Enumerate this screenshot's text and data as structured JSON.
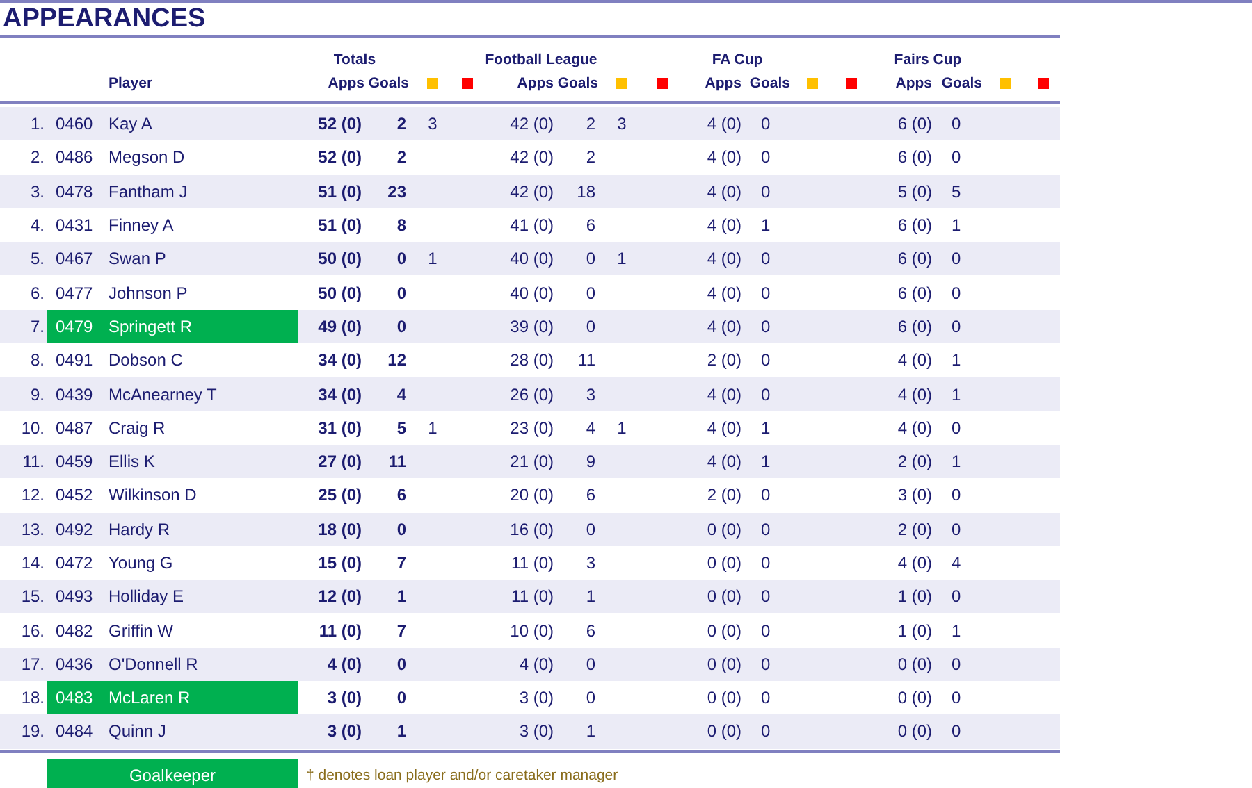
{
  "title": "APPEARANCES",
  "player_header": "Player",
  "groups": [
    {
      "title": "Totals",
      "apps_label": "Apps",
      "goals_label": "Goals"
    },
    {
      "title": "Football League",
      "apps_label": "Apps",
      "goals_label": "Goals"
    },
    {
      "title": "FA Cup",
      "apps_label": "Apps",
      "goals_label": "Goals"
    },
    {
      "title": "Fairs Cup",
      "apps_label": "Apps",
      "goals_label": "Goals"
    }
  ],
  "rows": [
    {
      "rank": "1.",
      "id": "0460",
      "name": "Kay A",
      "goalkeeper": false,
      "stats": [
        {
          "apps": "52 (0)",
          "goals": "2",
          "yellow": "3"
        },
        {
          "apps": "42 (0)",
          "goals": "2",
          "yellow": "3"
        },
        {
          "apps": "4 (0)",
          "goals": "0"
        },
        {
          "apps": "6 (0)",
          "goals": "0"
        }
      ]
    },
    {
      "rank": "2.",
      "id": "0486",
      "name": "Megson D",
      "goalkeeper": false,
      "stats": [
        {
          "apps": "52 (0)",
          "goals": "2"
        },
        {
          "apps": "42 (0)",
          "goals": "2"
        },
        {
          "apps": "4 (0)",
          "goals": "0"
        },
        {
          "apps": "6 (0)",
          "goals": "0"
        }
      ]
    },
    {
      "rank": "3.",
      "id": "0478",
      "name": "Fantham J",
      "goalkeeper": false,
      "stats": [
        {
          "apps": "51 (0)",
          "goals": "23"
        },
        {
          "apps": "42 (0)",
          "goals": "18"
        },
        {
          "apps": "4 (0)",
          "goals": "0"
        },
        {
          "apps": "5 (0)",
          "goals": "5"
        }
      ]
    },
    {
      "rank": "4.",
      "id": "0431",
      "name": "Finney A",
      "goalkeeper": false,
      "stats": [
        {
          "apps": "51 (0)",
          "goals": "8"
        },
        {
          "apps": "41 (0)",
          "goals": "6"
        },
        {
          "apps": "4 (0)",
          "goals": "1"
        },
        {
          "apps": "6 (0)",
          "goals": "1"
        }
      ]
    },
    {
      "rank": "5.",
      "id": "0467",
      "name": "Swan P",
      "goalkeeper": false,
      "stats": [
        {
          "apps": "50 (0)",
          "goals": "0",
          "yellow": "1"
        },
        {
          "apps": "40 (0)",
          "goals": "0",
          "yellow": "1"
        },
        {
          "apps": "4 (0)",
          "goals": "0"
        },
        {
          "apps": "6 (0)",
          "goals": "0"
        }
      ]
    },
    {
      "rank": "6.",
      "id": "0477",
      "name": "Johnson P",
      "goalkeeper": false,
      "stats": [
        {
          "apps": "50 (0)",
          "goals": "0"
        },
        {
          "apps": "40 (0)",
          "goals": "0"
        },
        {
          "apps": "4 (0)",
          "goals": "0"
        },
        {
          "apps": "6 (0)",
          "goals": "0"
        }
      ]
    },
    {
      "rank": "7.",
      "id": "0479",
      "name": "Springett R",
      "goalkeeper": true,
      "stats": [
        {
          "apps": "49 (0)",
          "goals": "0"
        },
        {
          "apps": "39 (0)",
          "goals": "0"
        },
        {
          "apps": "4 (0)",
          "goals": "0"
        },
        {
          "apps": "6 (0)",
          "goals": "0"
        }
      ]
    },
    {
      "rank": "8.",
      "id": "0491",
      "name": "Dobson C",
      "goalkeeper": false,
      "stats": [
        {
          "apps": "34 (0)",
          "goals": "12"
        },
        {
          "apps": "28 (0)",
          "goals": "11"
        },
        {
          "apps": "2 (0)",
          "goals": "0"
        },
        {
          "apps": "4 (0)",
          "goals": "1"
        }
      ]
    },
    {
      "rank": "9.",
      "id": "0439",
      "name": "McAnearney T",
      "goalkeeper": false,
      "stats": [
        {
          "apps": "34 (0)",
          "goals": "4"
        },
        {
          "apps": "26 (0)",
          "goals": "3"
        },
        {
          "apps": "4 (0)",
          "goals": "0"
        },
        {
          "apps": "4 (0)",
          "goals": "1"
        }
      ]
    },
    {
      "rank": "10.",
      "id": "0487",
      "name": "Craig R",
      "goalkeeper": false,
      "stats": [
        {
          "apps": "31 (0)",
          "goals": "5",
          "yellow": "1"
        },
        {
          "apps": "23 (0)",
          "goals": "4",
          "yellow": "1"
        },
        {
          "apps": "4 (0)",
          "goals": "1"
        },
        {
          "apps": "4 (0)",
          "goals": "0"
        }
      ]
    },
    {
      "rank": "11.",
      "id": "0459",
      "name": "Ellis K",
      "goalkeeper": false,
      "stats": [
        {
          "apps": "27 (0)",
          "goals": "11"
        },
        {
          "apps": "21 (0)",
          "goals": "9"
        },
        {
          "apps": "4 (0)",
          "goals": "1"
        },
        {
          "apps": "2 (0)",
          "goals": "1"
        }
      ]
    },
    {
      "rank": "12.",
      "id": "0452",
      "name": "Wilkinson D",
      "goalkeeper": false,
      "stats": [
        {
          "apps": "25 (0)",
          "goals": "6"
        },
        {
          "apps": "20 (0)",
          "goals": "6"
        },
        {
          "apps": "2 (0)",
          "goals": "0"
        },
        {
          "apps": "3 (0)",
          "goals": "0"
        }
      ]
    },
    {
      "rank": "13.",
      "id": "0492",
      "name": "Hardy R",
      "goalkeeper": false,
      "stats": [
        {
          "apps": "18 (0)",
          "goals": "0"
        },
        {
          "apps": "16 (0)",
          "goals": "0"
        },
        {
          "apps": "0 (0)",
          "goals": "0"
        },
        {
          "apps": "2 (0)",
          "goals": "0"
        }
      ]
    },
    {
      "rank": "14.",
      "id": "0472",
      "name": "Young G",
      "goalkeeper": false,
      "stats": [
        {
          "apps": "15 (0)",
          "goals": "7"
        },
        {
          "apps": "11 (0)",
          "goals": "3"
        },
        {
          "apps": "0 (0)",
          "goals": "0"
        },
        {
          "apps": "4 (0)",
          "goals": "4"
        }
      ]
    },
    {
      "rank": "15.",
      "id": "0493",
      "name": "Holliday E",
      "goalkeeper": false,
      "stats": [
        {
          "apps": "12 (0)",
          "goals": "1"
        },
        {
          "apps": "11 (0)",
          "goals": "1"
        },
        {
          "apps": "0 (0)",
          "goals": "0"
        },
        {
          "apps": "1 (0)",
          "goals": "0"
        }
      ]
    },
    {
      "rank": "16.",
      "id": "0482",
      "name": "Griffin W",
      "goalkeeper": false,
      "stats": [
        {
          "apps": "11 (0)",
          "goals": "7"
        },
        {
          "apps": "10 (0)",
          "goals": "6"
        },
        {
          "apps": "0 (0)",
          "goals": "0"
        },
        {
          "apps": "1 (0)",
          "goals": "1"
        }
      ]
    },
    {
      "rank": "17.",
      "id": "0436",
      "name": "O'Donnell R",
      "goalkeeper": false,
      "stats": [
        {
          "apps": "4 (0)",
          "goals": "0"
        },
        {
          "apps": "4 (0)",
          "goals": "0"
        },
        {
          "apps": "0 (0)",
          "goals": "0"
        },
        {
          "apps": "0 (0)",
          "goals": "0"
        }
      ]
    },
    {
      "rank": "18.",
      "id": "0483",
      "name": "McLaren R",
      "goalkeeper": true,
      "stats": [
        {
          "apps": "3 (0)",
          "goals": "0"
        },
        {
          "apps": "3 (0)",
          "goals": "0"
        },
        {
          "apps": "0 (0)",
          "goals": "0"
        },
        {
          "apps": "0 (0)",
          "goals": "0"
        }
      ]
    },
    {
      "rank": "19.",
      "id": "0484",
      "name": "Quinn J",
      "goalkeeper": false,
      "stats": [
        {
          "apps": "3 (0)",
          "goals": "1"
        },
        {
          "apps": "3 (0)",
          "goals": "1"
        },
        {
          "apps": "0 (0)",
          "goals": "0"
        },
        {
          "apps": "0 (0)",
          "goals": "0"
        }
      ]
    }
  ],
  "legend": {
    "goalkeeper_label": "Goalkeeper",
    "note": "† denotes loan player and/or caretaker manager"
  }
}
